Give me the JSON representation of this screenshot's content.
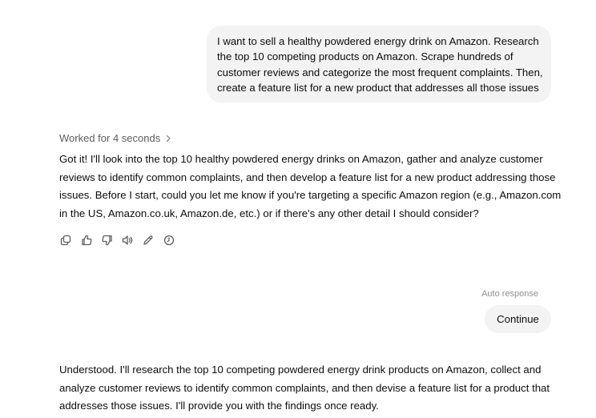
{
  "user_message": {
    "lines": [
      "I want to sell a healthy powdered energy drink on Amazon. Research",
      "the top 10 competing products on Amazon. Scrape hundreds of",
      "customer reviews and categorize the most frequent complaints. Then,",
      "create a feature list for a new product that addresses all those issues"
    ]
  },
  "assistant_1": {
    "worked_label": "Worked for 4 seconds",
    "lines": [
      "Got it! I'll look into the top 10 healthy powdered energy drinks on Amazon, gather and analyze customer",
      "reviews to identify common complaints, and then develop a feature list for a new product addressing those",
      "issues. Before I start, could you let me know if you're targeting a specific Amazon region (e.g., Amazon.com",
      "in the US, Amazon.co.uk, Amazon.de, etc.) or if there's any other detail I should consider?"
    ],
    "actions": [
      {
        "icon": "copy-icon"
      },
      {
        "icon": "thumbs-up-icon"
      },
      {
        "icon": "thumbs-down-icon"
      },
      {
        "icon": "read-aloud-icon"
      },
      {
        "icon": "edit-icon"
      },
      {
        "icon": "clock-icon"
      }
    ]
  },
  "auto_response": {
    "label": "Auto response",
    "text": "Continue"
  },
  "assistant_2": {
    "lines": [
      "Understood. I'll research the top 10 competing powdered energy drink products on Amazon, collect and",
      "analyze customer reviews to identify common complaints, and then devise a feature list for a product that",
      "addresses those issues. I'll provide you with the findings once ready."
    ]
  }
}
